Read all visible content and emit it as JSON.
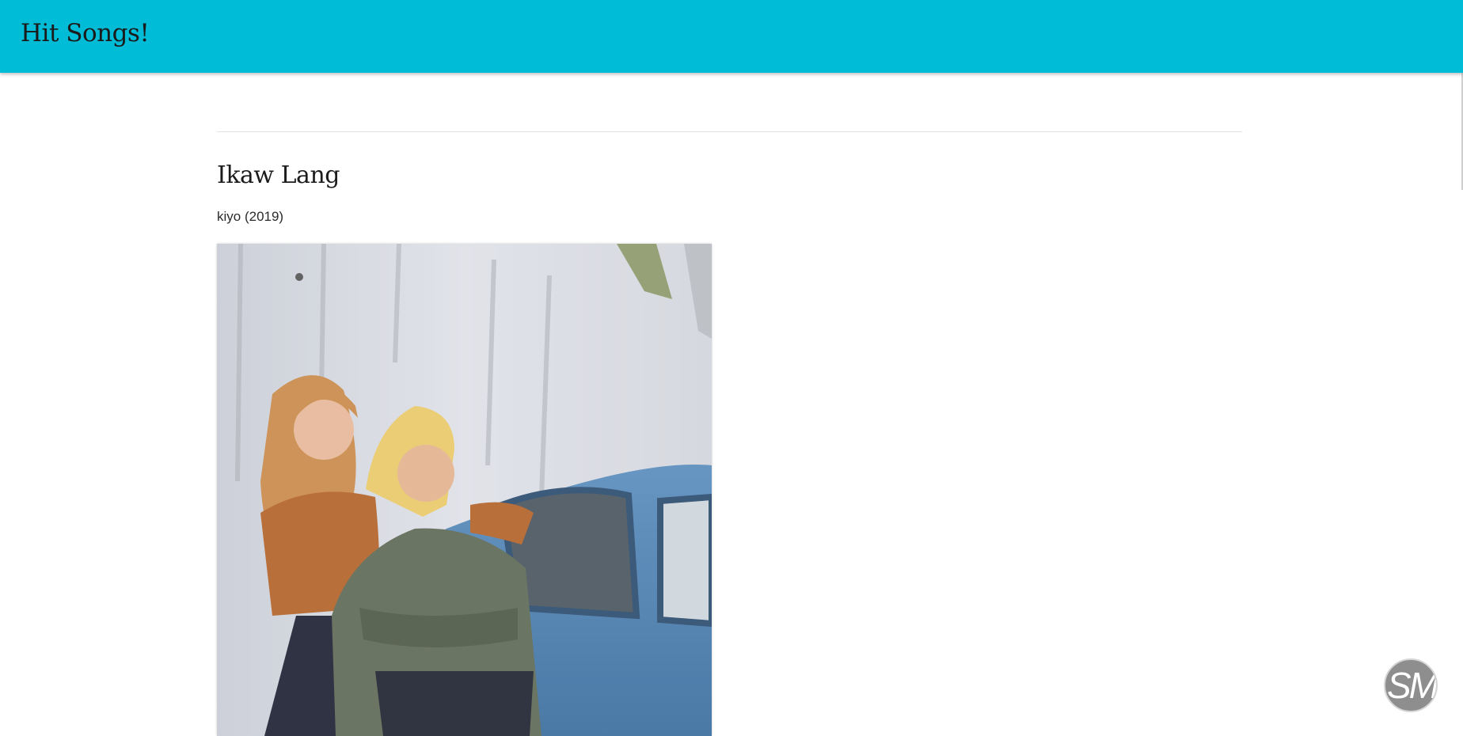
{
  "header": {
    "brand": "Hit Songs!",
    "background_color": "#00bcd6"
  },
  "song": {
    "title": "Ikaw Lang",
    "meta": "kiyo (2019)"
  },
  "cover_image": {
    "icon": "album-cover-image"
  },
  "widget": {
    "initials": "SM",
    "icon": "user-avatar"
  }
}
